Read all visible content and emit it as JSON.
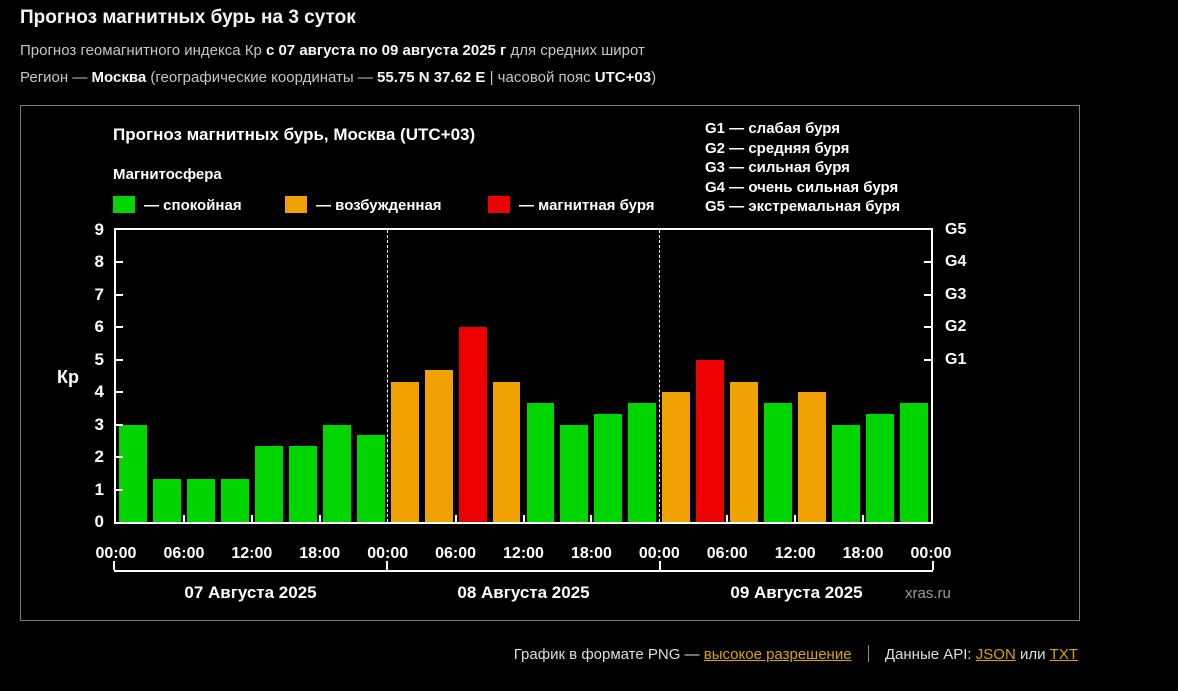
{
  "page": {
    "title": "Прогноз магнитных бурь на 3 суток",
    "subtitle": {
      "prefix": "Прогноз геомагнитного индекса Кр",
      "bold": "с 07 августа по 09 августа 2025 г",
      "suffix": "для средних широт"
    },
    "region": {
      "label": "Регион —",
      "name": "Москва",
      "coords_prefix": "(географические координаты —",
      "coords": "55.75 N 37.62 E",
      "tz_prefix": "| часовой пояс",
      "tz": "UTC+03",
      "close": ")"
    }
  },
  "chart": {
    "title": "Прогноз магнитных бурь, Москва (UTC+03)",
    "magnetosphere_label": "Магнитосфера",
    "legend": [
      {
        "key": "quiet",
        "label": "— спокойная"
      },
      {
        "key": "excited",
        "label": "— возбужденная"
      },
      {
        "key": "storm",
        "label": "— магнитная буря"
      }
    ],
    "g_scale_legend": [
      "G1 — слабая буря",
      "G2 — средняя буря",
      "G3 — сильная буря",
      "G4 — очень сильная буря",
      "G5 — экстремальная буря"
    ],
    "watermark": "xras.ru"
  },
  "chart_data": {
    "type": "bar",
    "title": "Прогноз магнитных бурь, Москва (UTC+03)",
    "ylabel": "Кр",
    "ylim": [
      0,
      9
    ],
    "yticks": [
      0,
      1,
      2,
      3,
      4,
      5,
      6,
      7,
      8,
      9
    ],
    "right_scale": [
      {
        "label": "G1",
        "value": 5
      },
      {
        "label": "G2",
        "value": 6
      },
      {
        "label": "G3",
        "value": 7
      },
      {
        "label": "G4",
        "value": 8
      },
      {
        "label": "G5",
        "value": 9
      }
    ],
    "time_labels": [
      "00:00",
      "06:00",
      "12:00",
      "18:00"
    ],
    "days": [
      {
        "date": "07 Августа 2025",
        "values": [
          3,
          1.33,
          1.33,
          1.33,
          2.33,
          2.33,
          3,
          2.67
        ]
      },
      {
        "date": "08 Августа 2025",
        "values": [
          4.33,
          4.67,
          6,
          4.33,
          3.67,
          3,
          3.33,
          3.67
        ]
      },
      {
        "date": "09 Августа 2025",
        "values": [
          4,
          5,
          4.33,
          3.67,
          4,
          3,
          3.33,
          3.67
        ]
      }
    ],
    "color_rules": {
      "storm_min": 5,
      "excited_min": 4
    },
    "colors": {
      "quiet": "#00d500",
      "excited": "#f0a202",
      "storm": "#ec0000"
    }
  },
  "footer": {
    "png_text": "График в формате PNG —",
    "png_link": "высокое разрешение",
    "api_text": "Данные API:",
    "json_link": "JSON",
    "or_text": "или",
    "txt_link": "TXT"
  }
}
